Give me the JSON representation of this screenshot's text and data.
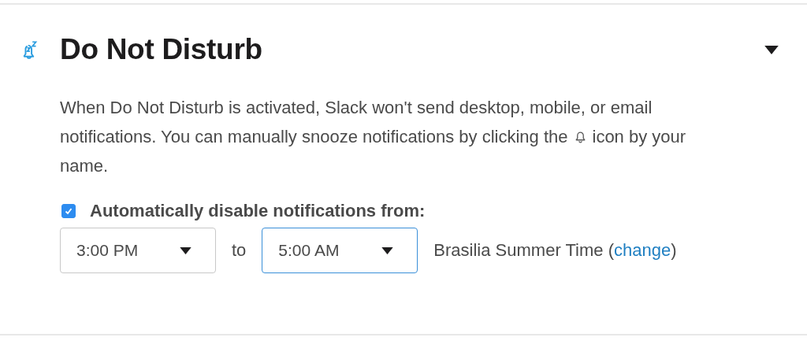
{
  "section": {
    "title": "Do Not Disturb",
    "expanded": true
  },
  "description": {
    "line_1": "When Do Not Disturb is activated, Slack won't send desktop, mobile, or email",
    "line_2_before_icon": "notifications. You can manually snooze notifications by clicking the",
    "line_2_after_icon": "icon by your",
    "line_3": "name."
  },
  "auto_disable": {
    "label": "Automatically disable notifications from:",
    "checked": true
  },
  "from_select": {
    "value": "3:00 PM",
    "focused": false
  },
  "separator": "to",
  "to_select": {
    "value": "5:00 AM",
    "focused": true
  },
  "timezone": {
    "before_link": "Brasilia Summer Time (",
    "link": "change",
    "after_link": ")"
  }
}
